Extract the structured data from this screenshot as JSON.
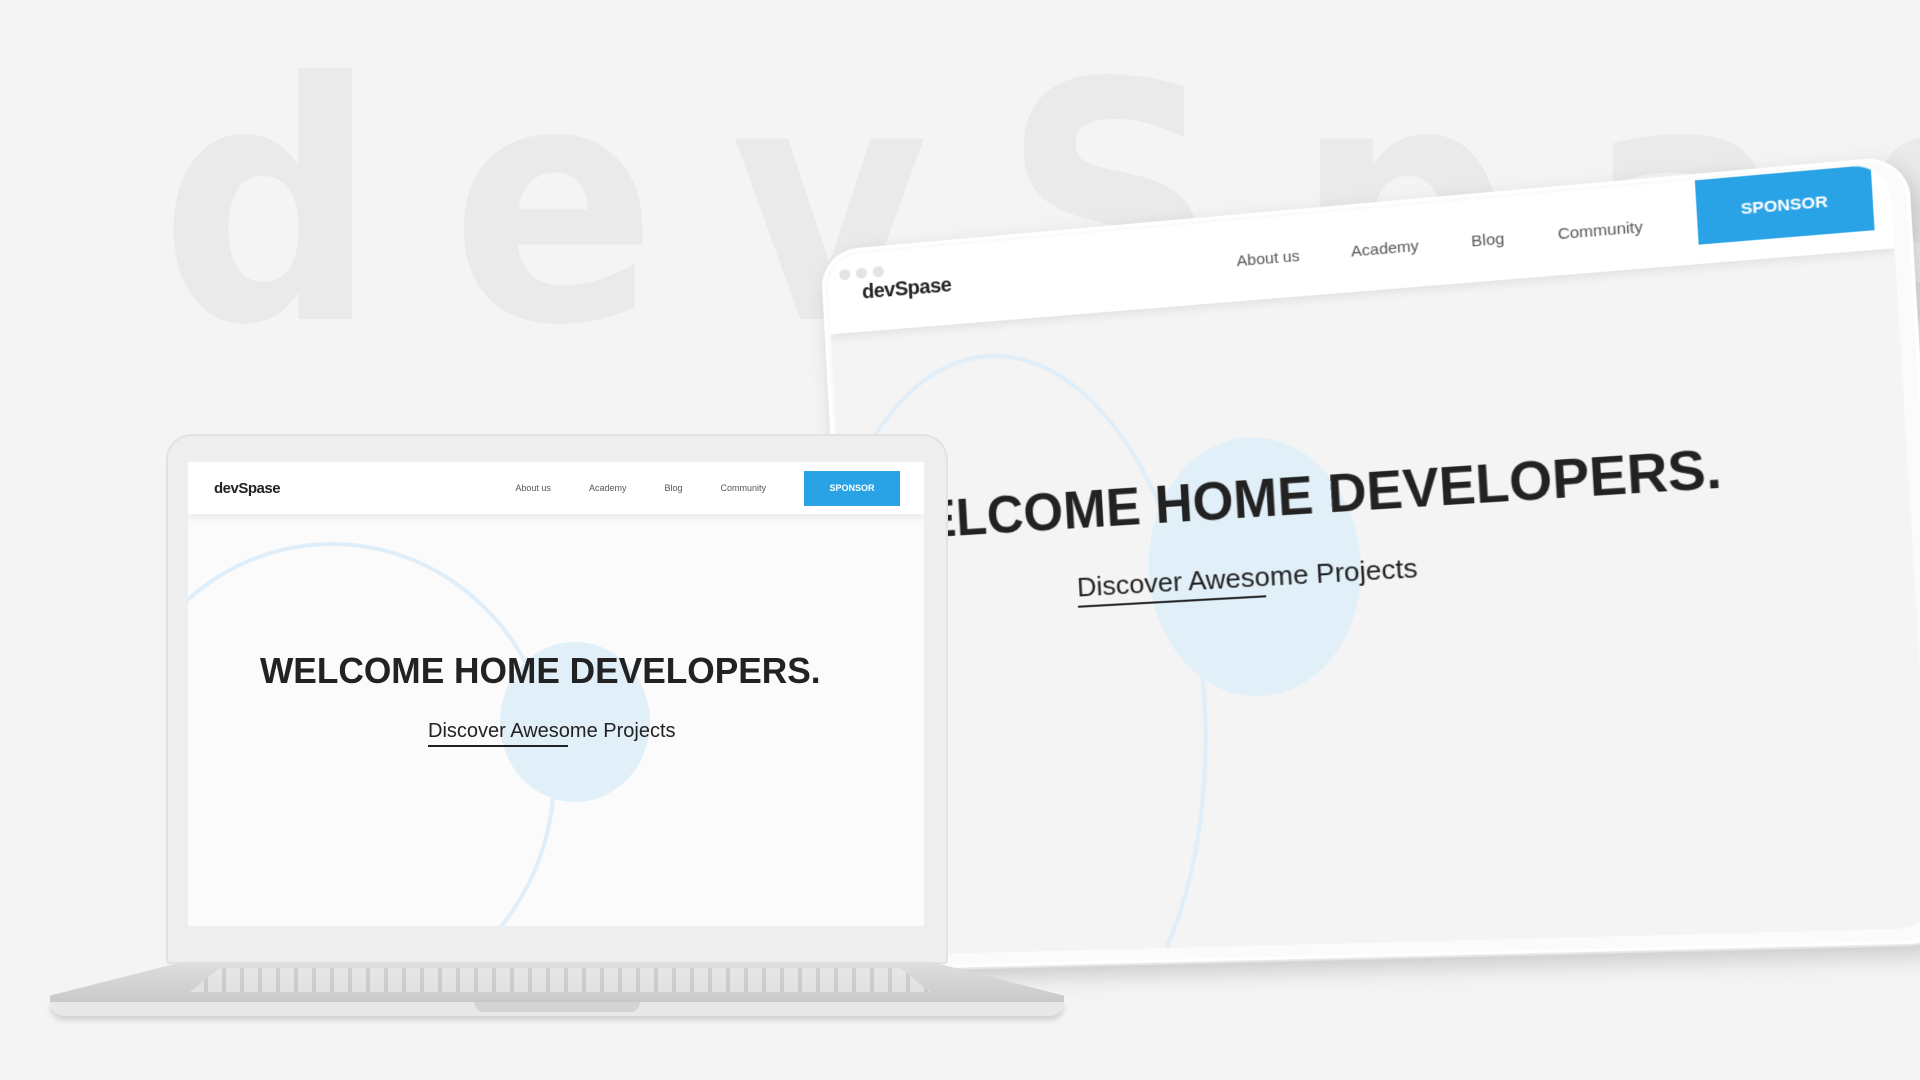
{
  "background_word": "devSpase",
  "site": {
    "logo": "devSpase",
    "nav": [
      "About us",
      "Academy",
      "Blog",
      "Community"
    ],
    "sponsor_label": "SPONSOR",
    "hero_title": "WELCOME HOME DEVELOPERS.",
    "hero_title_cropped": "ELCOME HOME DEVELOPERS.",
    "hero_subtitle": "Discover Awesome Projects"
  },
  "colors": {
    "accent": "#2aa3e6",
    "page_bg": "#f4f4f4",
    "decor_blue": "#e1eff9",
    "text": "#222222"
  }
}
